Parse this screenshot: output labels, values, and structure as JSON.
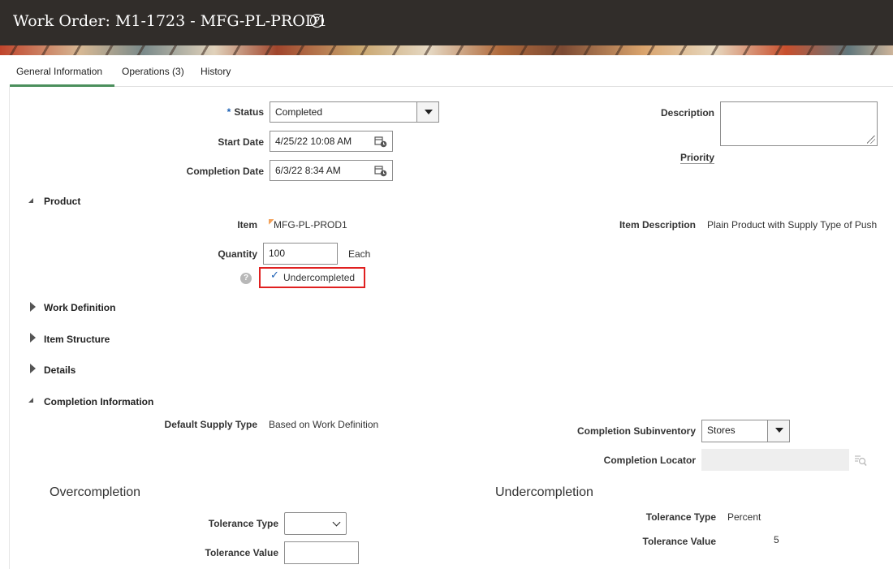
{
  "header": {
    "title": "Work Order: M1-1723 - MFG-PL-PROD1",
    "help_glyph": "?"
  },
  "tabs": [
    {
      "label": "General Information",
      "active": true
    },
    {
      "label": "Operations (3)"
    },
    {
      "label": "History"
    }
  ],
  "general": {
    "status": {
      "required_mark": "*",
      "label": "Status",
      "value": "Completed"
    },
    "start_date": {
      "label": "Start Date",
      "value": "4/25/22 10:08 AM"
    },
    "completion_date": {
      "label": "Completion Date",
      "value": "6/3/22 8:34 AM"
    },
    "description": {
      "label": "Description",
      "value": ""
    },
    "priority": {
      "label": "Priority"
    }
  },
  "product": {
    "section_label": "Product",
    "item_label": "Item",
    "item_value": "MFG-PL-PROD1",
    "item_description_label": "Item Description",
    "item_description_value": "Plain Product with Supply Type of Push",
    "quantity_label": "Quantity",
    "quantity_value": "100",
    "uom": "Each",
    "undercompleted_label": "Undercompleted",
    "undercompleted_checked": true,
    "check_glyph": "✓",
    "help_glyph": "?"
  },
  "sections": {
    "work_definition": "Work Definition",
    "item_structure": "Item Structure",
    "details": "Details",
    "completion_information": "Completion Information"
  },
  "completion": {
    "default_supply_type_label": "Default Supply Type",
    "default_supply_type_value": "Based on Work Definition",
    "completion_subinventory_label": "Completion Subinventory",
    "completion_subinventory_value": "Stores",
    "completion_locator_label": "Completion Locator",
    "completion_locator_value": ""
  },
  "overcompletion": {
    "heading": "Overcompletion",
    "tolerance_type_label": "Tolerance Type",
    "tolerance_type_value": "",
    "tolerance_value_label": "Tolerance Value",
    "tolerance_value_value": ""
  },
  "undercompletion": {
    "heading": "Undercompletion",
    "tolerance_type_label": "Tolerance Type",
    "tolerance_type_value": "Percent",
    "tolerance_value_label": "Tolerance Value",
    "tolerance_value_value": "5"
  },
  "icons": {
    "calendar": "calendar-icon",
    "search": "search-icon",
    "flag": "item-flag-icon"
  },
  "colors": {
    "header_bg": "#312d2a",
    "tab_underline": "#4b8f5c",
    "highlight_border": "#e02020",
    "required_mark": "#1a5fb4"
  }
}
